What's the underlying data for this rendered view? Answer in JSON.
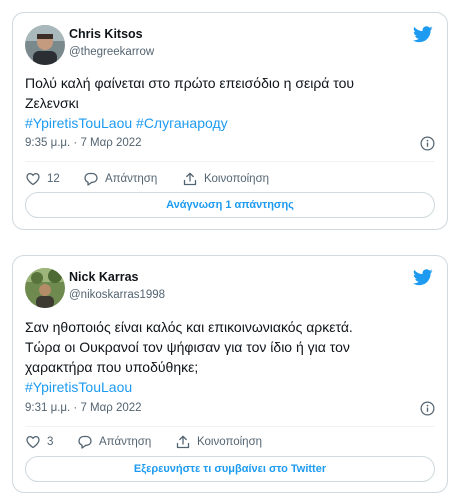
{
  "brand_color": "#1d9bf0",
  "tweets": [
    {
      "display_name": "Chris Kitsos",
      "handle": "@thegreekarrow",
      "text_line1": "Πολύ καλή φαίνεται στο πρώτο επεισόδιο η σειρά του",
      "text_line2": "Ζελενσκι",
      "hashtags": "#YpiretisTouLaou #Слуганароду",
      "timestamp": "9:35 μ.μ. · 7 Μαρ 2022",
      "likes": "12",
      "reply_label": "Απάντηση",
      "share_label": "Κοινοποίηση",
      "cta_label": "Ανάγνωση 1 απάντησης"
    },
    {
      "display_name": "Nick Karras",
      "handle": "@nikoskarras1998",
      "text_line1": "Σαν ηθοποιός είναι καλός και επικοινωνιακός αρκετά.",
      "text_line2": "Τώρα οι Ουκρανοί τον ψήφισαν για τον ίδιο ή για τον",
      "text_line3": "χαρακτήρα που υποδύθηκε;",
      "hashtags": "#YpiretisTouLaou",
      "timestamp": "9:31 μ.μ. · 7 Μαρ 2022",
      "likes": "3",
      "reply_label": "Απάντηση",
      "share_label": "Κοινοποίηση",
      "cta_label": "Εξερευνήστε τι συμβαίνει στο Twitter"
    }
  ],
  "icons": [
    "twitter-bird-icon",
    "info-icon",
    "heart-icon",
    "reply-bubble-icon",
    "share-icon"
  ]
}
